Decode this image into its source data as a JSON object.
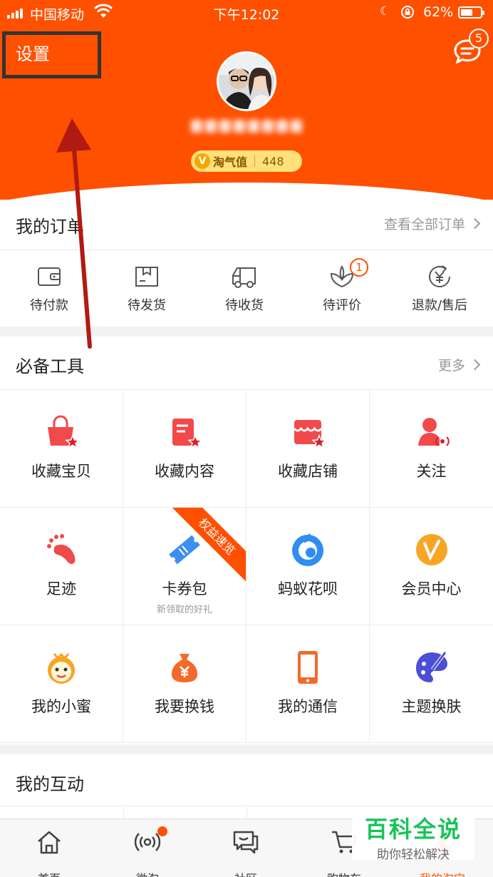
{
  "status_bar": {
    "carrier": "中国移动",
    "time": "下午12:02",
    "battery_text": "62%"
  },
  "header": {
    "settings_label": "设置",
    "message_count": "5",
    "taoqi_label": "淘气值",
    "taoqi_value": "448",
    "taoqi_badge": "V"
  },
  "orders": {
    "title": "我的订单",
    "view_all_label": "查看全部订单",
    "items": [
      {
        "label": "待付款",
        "icon": "wallet-icon"
      },
      {
        "label": "待发货",
        "icon": "package-icon"
      },
      {
        "label": "待收货",
        "icon": "truck-icon"
      },
      {
        "label": "待评价",
        "icon": "review-icon",
        "badge": "1"
      },
      {
        "label": "退款/售后",
        "icon": "refund-icon"
      }
    ]
  },
  "tools": {
    "title": "必备工具",
    "more_label": "更多",
    "items": [
      {
        "label": "收藏宝贝",
        "icon": "favorite-items-icon"
      },
      {
        "label": "收藏内容",
        "icon": "favorite-content-icon"
      },
      {
        "label": "收藏店铺",
        "icon": "favorite-shop-icon"
      },
      {
        "label": "关注",
        "icon": "follow-icon"
      },
      {
        "label": "足迹",
        "icon": "footprint-icon"
      },
      {
        "label": "卡券包",
        "sub": "新领取的好礼",
        "ribbon": "权益速览",
        "icon": "coupon-icon"
      },
      {
        "label": "蚂蚁花呗",
        "icon": "huabei-icon"
      },
      {
        "label": "会员中心",
        "icon": "member-center-icon"
      },
      {
        "label": "我的小蜜",
        "icon": "xiaomi-assistant-icon"
      },
      {
        "label": "我要换钱",
        "icon": "money-bag-icon"
      },
      {
        "label": "我的通信",
        "icon": "phone-icon"
      },
      {
        "label": "主题换肤",
        "icon": "theme-palette-icon"
      }
    ]
  },
  "interactions": {
    "title": "我的互动"
  },
  "tabbar": {
    "items": [
      {
        "label": "首页",
        "icon": "home-icon"
      },
      {
        "label": "微淘",
        "icon": "broadcast-icon"
      },
      {
        "label": "社区",
        "icon": "community-icon"
      },
      {
        "label": "购物车",
        "icon": "cart-icon"
      },
      {
        "label": "我的淘宝",
        "icon": "my-taobao-icon"
      }
    ]
  },
  "watermark": {
    "title": "百科全说",
    "subtitle": "助你轻松解决"
  },
  "colors": {
    "brand": "#ff5000",
    "annotation_arrow": "#b01a12",
    "watermark_green": "#19c35a"
  }
}
